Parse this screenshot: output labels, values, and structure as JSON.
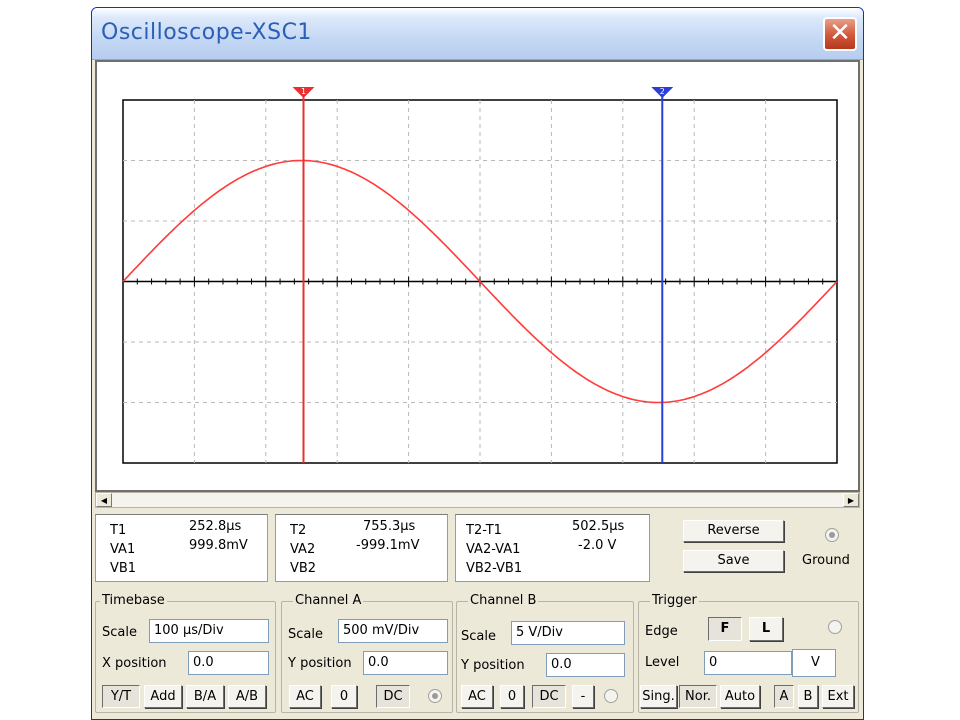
{
  "window": {
    "title": "Oscilloscope-XSC1",
    "close_glyph": "✕"
  },
  "colors": {
    "trace_a": "#ff3b3b",
    "cursor1": "#e83030",
    "cursor2": "#2a3fd8",
    "grid": "#b8b8b8",
    "screen_bg": "#ffffff"
  },
  "display": {
    "cursor1_label": "1",
    "cursor2_label": "2",
    "cursor1_time_div": 2.528,
    "cursor2_time_div": 7.553
  },
  "chart_data": {
    "type": "line",
    "series": [
      {
        "name": "Channel A",
        "period_us": 1000,
        "amplitude_v": 1.0,
        "x_us": [
          0,
          100,
          200,
          250,
          300,
          400,
          500,
          600,
          700,
          750,
          800,
          900,
          1000
        ],
        "y_v": [
          0,
          0.588,
          0.951,
          1.0,
          0.951,
          0.588,
          0,
          -0.588,
          -0.951,
          -1.0,
          -0.951,
          -0.588,
          0
        ]
      }
    ],
    "xlim": [
      0,
      1000
    ],
    "ylim": [
      -1.5,
      1.5
    ],
    "x_unit": "μs",
    "y_unit": "V",
    "x_divisions": 10,
    "y_divisions": 6,
    "grid": true
  },
  "readouts": {
    "t1": {
      "label": "T1",
      "value": "252.8μs",
      "va_label": "VA1",
      "va": "999.8mV",
      "vb_label": "VB1",
      "vb": ""
    },
    "t2": {
      "label": "T2",
      "value": "755.3μs",
      "va_label": "VA2",
      "va": "-999.1mV",
      "vb_label": "VB2",
      "vb": ""
    },
    "diff": {
      "label": "T2-T1",
      "value": "502.5μs",
      "va_label": "VA2-VA1",
      "va": "-2.0 V",
      "vb_label": "VB2-VB1",
      "vb": ""
    }
  },
  "buttons": {
    "reverse": "Reverse",
    "save": "Save",
    "ground": "Ground"
  },
  "timebase": {
    "title": "Timebase",
    "scale_label": "Scale",
    "scale": "100 μs/Div",
    "xpos_label": "X position",
    "xpos": "0.0",
    "modes": [
      "Y/T",
      "Add",
      "B/A",
      "A/B"
    ]
  },
  "channel_a": {
    "title": "Channel A",
    "scale_label": "Scale",
    "scale": "500 mV/Div",
    "ypos_label": "Y position",
    "ypos": "0.0",
    "coupling": [
      "AC",
      "0",
      "DC"
    ]
  },
  "channel_b": {
    "title": "Channel B",
    "scale_label": "Scale",
    "scale": "5 V/Div",
    "ypos_label": "Y position",
    "ypos": "0.0",
    "coupling": [
      "AC",
      "0",
      "DC",
      "-"
    ]
  },
  "trigger": {
    "title": "Trigger",
    "edge_label": "Edge",
    "rising_glyph": "F",
    "falling_glyph": "L",
    "level_label": "Level",
    "level": "0",
    "level_unit": "V",
    "modes": [
      "Sing.",
      "Nor.",
      "Auto",
      "A",
      "B",
      "Ext"
    ]
  }
}
